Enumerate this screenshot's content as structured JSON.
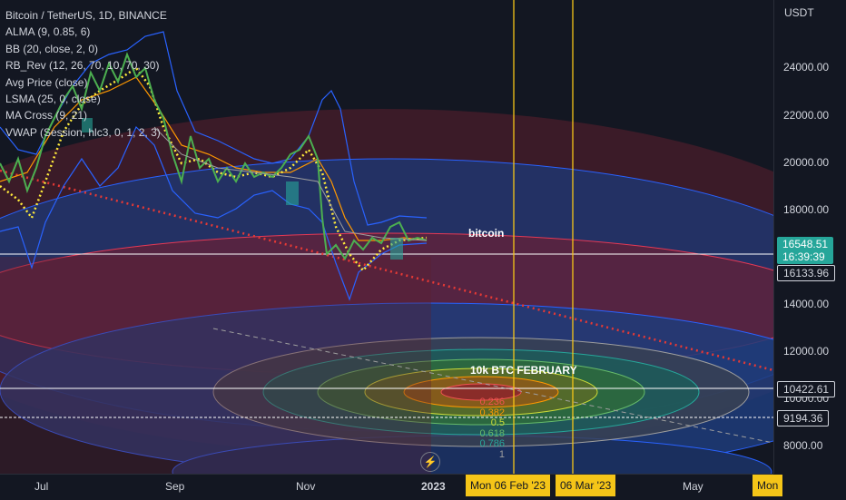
{
  "legend": {
    "title": "Bitcoin / TetherUS, 1D, BINANCE",
    "indicators": [
      "ALMA (9, 0.85, 6)",
      "BB (20, close, 2, 0)",
      "RB_Rev (12, 26, 70, 10, 70, 30)",
      "Avg Price (close)",
      "LSMA (25, 0, close)",
      "MA Cross (9, 21)",
      "VWAP (Session, hlc3, 0, 1, 2, 3)"
    ]
  },
  "y_axis": {
    "unit": "USDT",
    "ticks": [
      "24000.00",
      "22000.00",
      "20000.00",
      "18000.00",
      "14000.00",
      "12000.00",
      "10000.00",
      "8000.00"
    ]
  },
  "x_axis": {
    "ticks": [
      "Jul",
      "Sep",
      "Nov",
      "2023",
      "May"
    ]
  },
  "price_tags": {
    "current_price": "16548.51",
    "countdown": "16:39:39",
    "level_1": "16133.96",
    "level_2": "10422.61",
    "level_3": "9194.36"
  },
  "date_tags": {
    "line_1": "Mon 06 Feb '23",
    "line_2": "06 Mar '23",
    "edge": "Mon"
  },
  "annotations": {
    "bitcoin": "bitcoin",
    "target": "10k BTC FEBRUARY"
  },
  "fib_levels": [
    "0.236",
    "0.382",
    "0.5",
    "0.618",
    "0.786",
    "1"
  ],
  "colors": {
    "background": "#131722",
    "up_green": "#26a69a",
    "vertical_lines": "#f5c518",
    "bb_band": "#2962ff",
    "price_line": "#4caf50",
    "dotted_trend": "#e53935"
  }
}
